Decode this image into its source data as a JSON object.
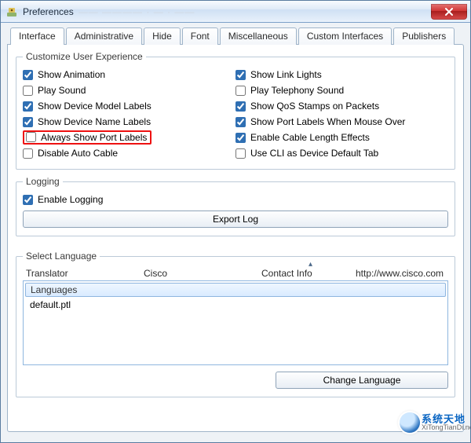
{
  "window": {
    "title": "Preferences"
  },
  "tabs": [
    {
      "label": "Interface"
    },
    {
      "label": "Administrative"
    },
    {
      "label": "Hide"
    },
    {
      "label": "Font"
    },
    {
      "label": "Miscellaneous"
    },
    {
      "label": "Custom Interfaces"
    },
    {
      "label": "Publishers"
    }
  ],
  "groups": {
    "ux": {
      "legend": "Customize User Experience",
      "left": [
        {
          "label": "Show Animation",
          "checked": true
        },
        {
          "label": "Play Sound",
          "checked": false
        },
        {
          "label": "Show Device Model Labels",
          "checked": true
        },
        {
          "label": "Show Device Name Labels",
          "checked": true
        },
        {
          "label": "Always Show Port Labels",
          "checked": false,
          "highlight": true
        },
        {
          "label": "Disable Auto Cable",
          "checked": false
        }
      ],
      "right": [
        {
          "label": "Show Link Lights",
          "checked": true
        },
        {
          "label": "Play Telephony Sound",
          "checked": false
        },
        {
          "label": "Show QoS Stamps on Packets",
          "checked": true
        },
        {
          "label": "Show Port Labels When Mouse Over",
          "checked": true
        },
        {
          "label": "Enable Cable Length Effects",
          "checked": true
        },
        {
          "label": "Use CLI as Device Default Tab",
          "checked": false
        }
      ]
    },
    "logging": {
      "legend": "Logging",
      "enable_label": "Enable Logging",
      "enable_checked": true,
      "export_label": "Export Log"
    },
    "language": {
      "legend": "Select Language",
      "cols": {
        "translator": "Translator",
        "cisco": "Cisco",
        "contact": "Contact Info",
        "url": "http://www.cisco.com"
      },
      "selected": "Languages",
      "items": [
        "default.ptl"
      ],
      "change_label": "Change Language"
    }
  },
  "watermark": {
    "line1": "系统天地",
    "line2": "XiTongTianDi.net"
  }
}
